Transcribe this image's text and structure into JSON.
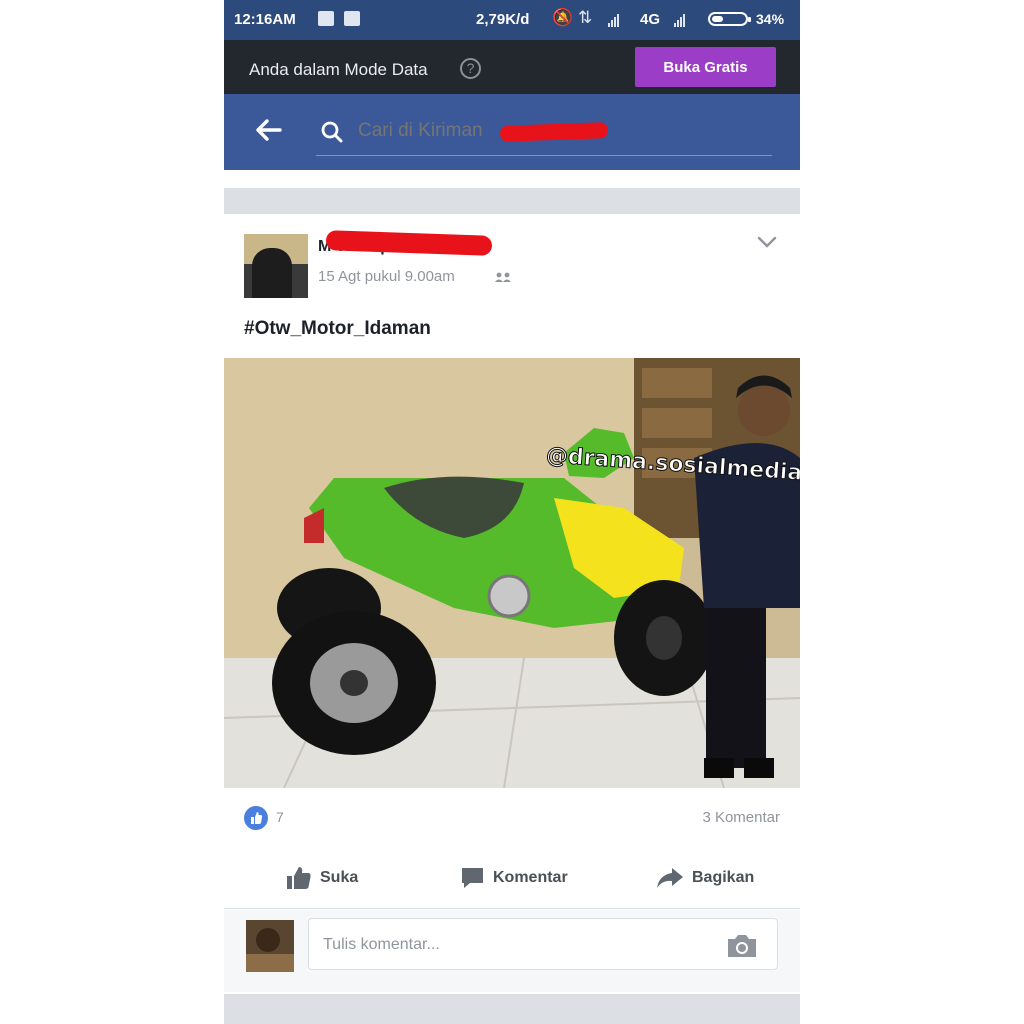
{
  "status_bar": {
    "time": "12:16AM",
    "speed": "2,79K/d",
    "network": "4G",
    "battery": "34%",
    "battery_level": 0.34
  },
  "data_mode": {
    "message": "Anda dalam Mode Data",
    "help_icon": "?",
    "button_label": "Buka Gratis",
    "button_color": "#9b3dc6"
  },
  "search": {
    "placeholder": "Cari di Kiriman",
    "header_color": "#3b5998"
  },
  "post": {
    "author": "M Thonq",
    "timestamp": "15 Agt pukul 9.00am",
    "privacy_separator": "•",
    "caption": "#Otw_Motor_Idaman",
    "photo_watermark": "@drama.sosialmedia",
    "like_count": "7",
    "comment_count": "3 Komentar",
    "actions": {
      "like": "Suka",
      "comment": "Komentar",
      "share": "Bagikan"
    },
    "comment_placeholder": "Tulis komentar..."
  }
}
